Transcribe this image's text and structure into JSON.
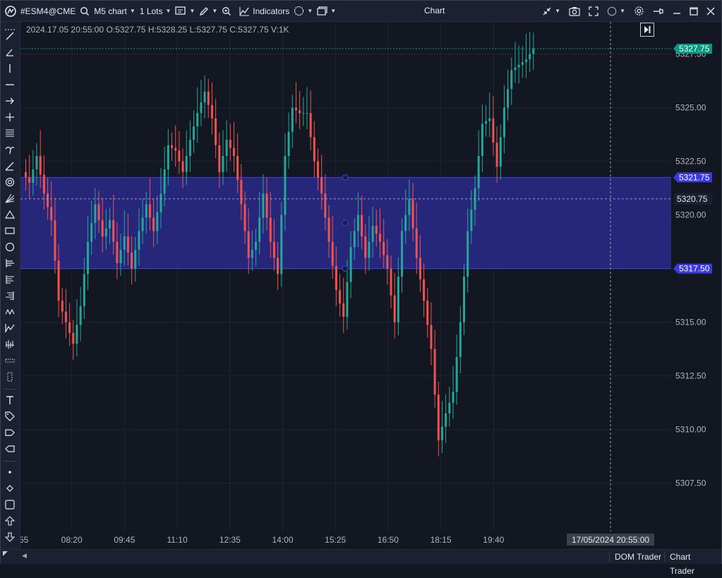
{
  "toolbar": {
    "symbol": "#ESM4@CME",
    "timeframe": "M5 chart",
    "lots": "1 Lots",
    "indicators": "Indicators",
    "title": "Chart"
  },
  "ohlc_readout": "2024.17.05 20:55:00 O:5327.75 H:5328.25 L:5327.75 C:5327.75 V:1K",
  "bottom": {
    "dom_trader": "DOM Trader",
    "chart_trader": "Chart Trader"
  },
  "colors": {
    "background": "#131722",
    "bull": "#26a69a",
    "bear": "#ef5350",
    "zone_fill": "#2a2a8a",
    "zone_line": "#4040e0",
    "current_price": "#089981"
  },
  "chart_data": {
    "type": "candlestick",
    "instrument": "#ESM4@CME",
    "timeframe": "M5",
    "ylim": [
      5305.25,
      5329.0
    ],
    "y_ticks": [
      "5327.50",
      "5325.00",
      "5322.50",
      "5320.00",
      "5317.50",
      "5315.00",
      "5312.50",
      "5310.00",
      "5307.50"
    ],
    "x_ticks": [
      "55",
      "08:20",
      "09:45",
      "11:10",
      "12:35",
      "14:00",
      "15:25",
      "16:50",
      "18:15",
      "19:40"
    ],
    "crosshair_time": "17/05/2024 20:55:00",
    "crosshair_price": "5320.75",
    "current_price": "5327.75",
    "zone": {
      "top": 5321.75,
      "bottom": 5317.5,
      "top_label": "5321.75",
      "bottom_label": "5317.50"
    },
    "closes": [
      5321.5,
      5322.75,
      5321.0,
      5319.75,
      5316.0,
      5315.0,
      5314.0,
      5315.75,
      5318.75,
      5320.5,
      5319.0,
      5319.75,
      5317.75,
      5319.0,
      5317.5,
      5319.25,
      5320.5,
      5319.25,
      5321.0,
      5323.25,
      5323.0,
      5322.0,
      5323.5,
      5324.75,
      5325.75,
      5324.5,
      5322.0,
      5323.5,
      5322.75,
      5320.5,
      5318.0,
      5318.75,
      5321.0,
      5318.75,
      5317.25,
      5322.75,
      5325.0,
      5324.75,
      5324.75,
      5322.5,
      5321.0,
      5318.75,
      5316.5,
      5315.25,
      5318.5,
      5320.0,
      5318.0,
      5319.5,
      5318.75,
      5317.5,
      5315.0,
      5319.25,
      5320.75,
      5318.0,
      5316.0,
      5313.75,
      5309.5,
      5310.75,
      5311.75,
      5315.0,
      5319.25,
      5321.25,
      5324.25,
      5324.5,
      5322.25,
      5325.0,
      5326.75,
      5327.0,
      5327.25,
      5327.75
    ]
  }
}
